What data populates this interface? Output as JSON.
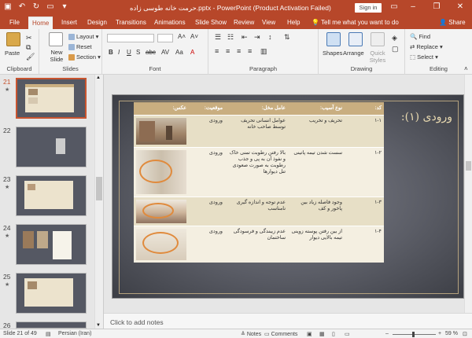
{
  "window": {
    "title": "حرمت خانه طوسی زاده.pptx  -  PowerPoint (Product Activation Failed)",
    "sign_in": "Sign in"
  },
  "tabs": [
    "File",
    "Home",
    "Insert",
    "Design",
    "Transitions",
    "Animations",
    "Slide Show",
    "Review",
    "View",
    "Help"
  ],
  "active_tab": "Home",
  "tell_me": "Tell me what you want to do",
  "share": "Share",
  "ribbon": {
    "paste": "Paste",
    "clipboard": "Clipboard",
    "new_slide": "New Slide",
    "layout": "Layout",
    "reset": "Reset",
    "section": "Section",
    "slides": "Slides",
    "font": "Font",
    "paragraph": "Paragraph",
    "shapes": "Shapes",
    "arrange": "Arrange",
    "quick_styles": "Quick Styles",
    "drawing": "Drawing",
    "find": "Find",
    "replace": "Replace",
    "select": "Select",
    "editing": "Editing"
  },
  "thumbnails": [
    {
      "num": "21",
      "selected": true
    },
    {
      "num": "22",
      "selected": false
    },
    {
      "num": "23",
      "selected": false
    },
    {
      "num": "24",
      "selected": false
    },
    {
      "num": "25",
      "selected": false
    },
    {
      "num": "26",
      "selected": false
    }
  ],
  "slide": {
    "title": "ورودی (۱):",
    "headers": [
      "کد:",
      "نوع آسیب:",
      "عامل مخل:",
      "موقعیت:",
      "عکس:"
    ],
    "rows": [
      {
        "code": "۱-۱",
        "damage": "تحریف و تخریب",
        "agent": "عوامل انسانی تحریف توسط صاحب خانه",
        "location": "ورودی"
      },
      {
        "code": "۱-۲",
        "damage": "سست شدن تیمه پاتینی",
        "agent": "بالا رفتن رطوبت تمنی خاک و نفوذ آن به پی و جذب رطوبت به صورت صعودی تنل دیوارها",
        "location": "ورودی"
      },
      {
        "code": "۱-۳",
        "damage": "وجود فاصله زیاد بین پاخور و کف",
        "agent": "عدم توجه و اندازه گیری نامناسب",
        "location": "ورودی"
      },
      {
        "code": "۱-۴",
        "damage": "از بین رفتن پوسته زوینی تیمه بالایی دیوار",
        "agent": "عدم زیبندگی و فرسودگی ساختمان",
        "location": "ورودی"
      }
    ]
  },
  "notes_placeholder": "Click to add notes",
  "status": {
    "slide_of": "Slide 21 of 49",
    "language": "Persian (Iran)",
    "notes": "Notes",
    "comments": "Comments",
    "zoom": "59 %"
  },
  "colors": {
    "accent": "#b7472a",
    "table_header": "#c9ae80",
    "slide_bg": "#5b5d66",
    "title_text": "#e8d9b0"
  }
}
